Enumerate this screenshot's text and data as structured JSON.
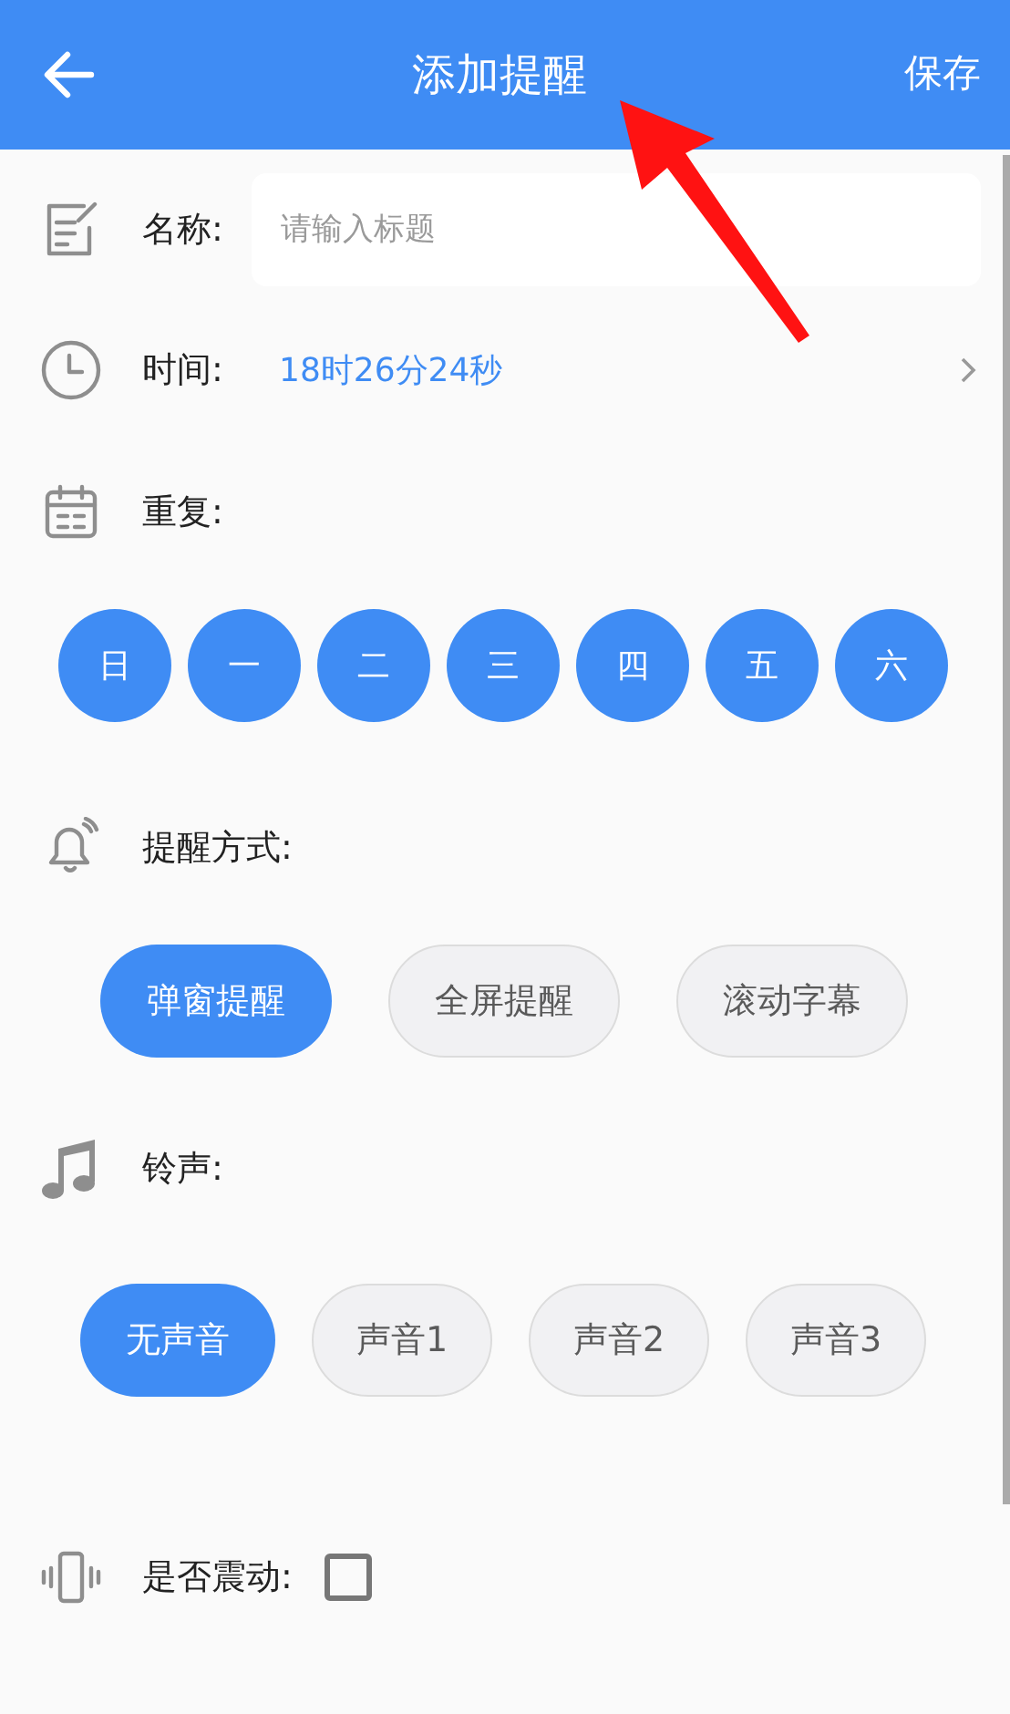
{
  "header": {
    "title": "添加提醒",
    "save": "保存"
  },
  "name_row": {
    "label": "名称:",
    "placeholder": "请输入标题"
  },
  "time_row": {
    "label": "时间:",
    "value": "18时26分24秒"
  },
  "repeat": {
    "label": "重复:",
    "days": [
      {
        "label": "日",
        "selected": true
      },
      {
        "label": "一",
        "selected": true
      },
      {
        "label": "二",
        "selected": true
      },
      {
        "label": "三",
        "selected": true
      },
      {
        "label": "四",
        "selected": true
      },
      {
        "label": "五",
        "selected": true
      },
      {
        "label": "六",
        "selected": true
      }
    ]
  },
  "reminder_mode": {
    "label": "提醒方式:",
    "options": [
      {
        "label": "弹窗提醒",
        "selected": true
      },
      {
        "label": "全屏提醒",
        "selected": false
      },
      {
        "label": "滚动字幕",
        "selected": false
      }
    ]
  },
  "ringtone": {
    "label": "铃声:",
    "options": [
      {
        "label": "无声音",
        "selected": true
      },
      {
        "label": "声音1",
        "selected": false
      },
      {
        "label": "声音2",
        "selected": false
      },
      {
        "label": "声音3",
        "selected": false
      }
    ]
  },
  "vibrate": {
    "label": "是否震动:",
    "checked": false
  }
}
